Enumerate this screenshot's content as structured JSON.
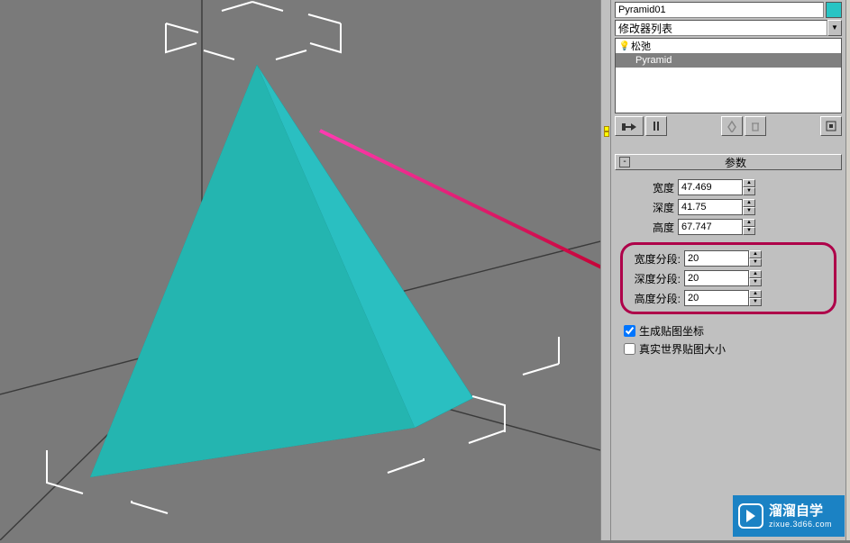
{
  "object_name": "Pyramid01",
  "modifier_list_label": "修改器列表",
  "stack": {
    "relax": "松弛",
    "pyramid": "Pyramid"
  },
  "rollout_title": "参数",
  "params": {
    "width_label": "宽度",
    "width_value": "47.469",
    "depth_label": "深度",
    "depth_value": "41.75",
    "height_label": "高度",
    "height_value": "67.747",
    "wseg_label": "宽度分段:",
    "wseg_value": "20",
    "dseg_label": "深度分段:",
    "dseg_value": "20",
    "hseg_label": "高度分段:",
    "hseg_value": "20",
    "gen_mapping_label": "生成贴图坐标",
    "real_world_label": "真实世界贴图大小"
  },
  "watermark": {
    "title": "溜溜自学",
    "url": "zixue.3d66.com"
  },
  "colors": {
    "swatch": "#28c4c4",
    "accent": "#1b82c4",
    "highlight": "#ae0049"
  }
}
